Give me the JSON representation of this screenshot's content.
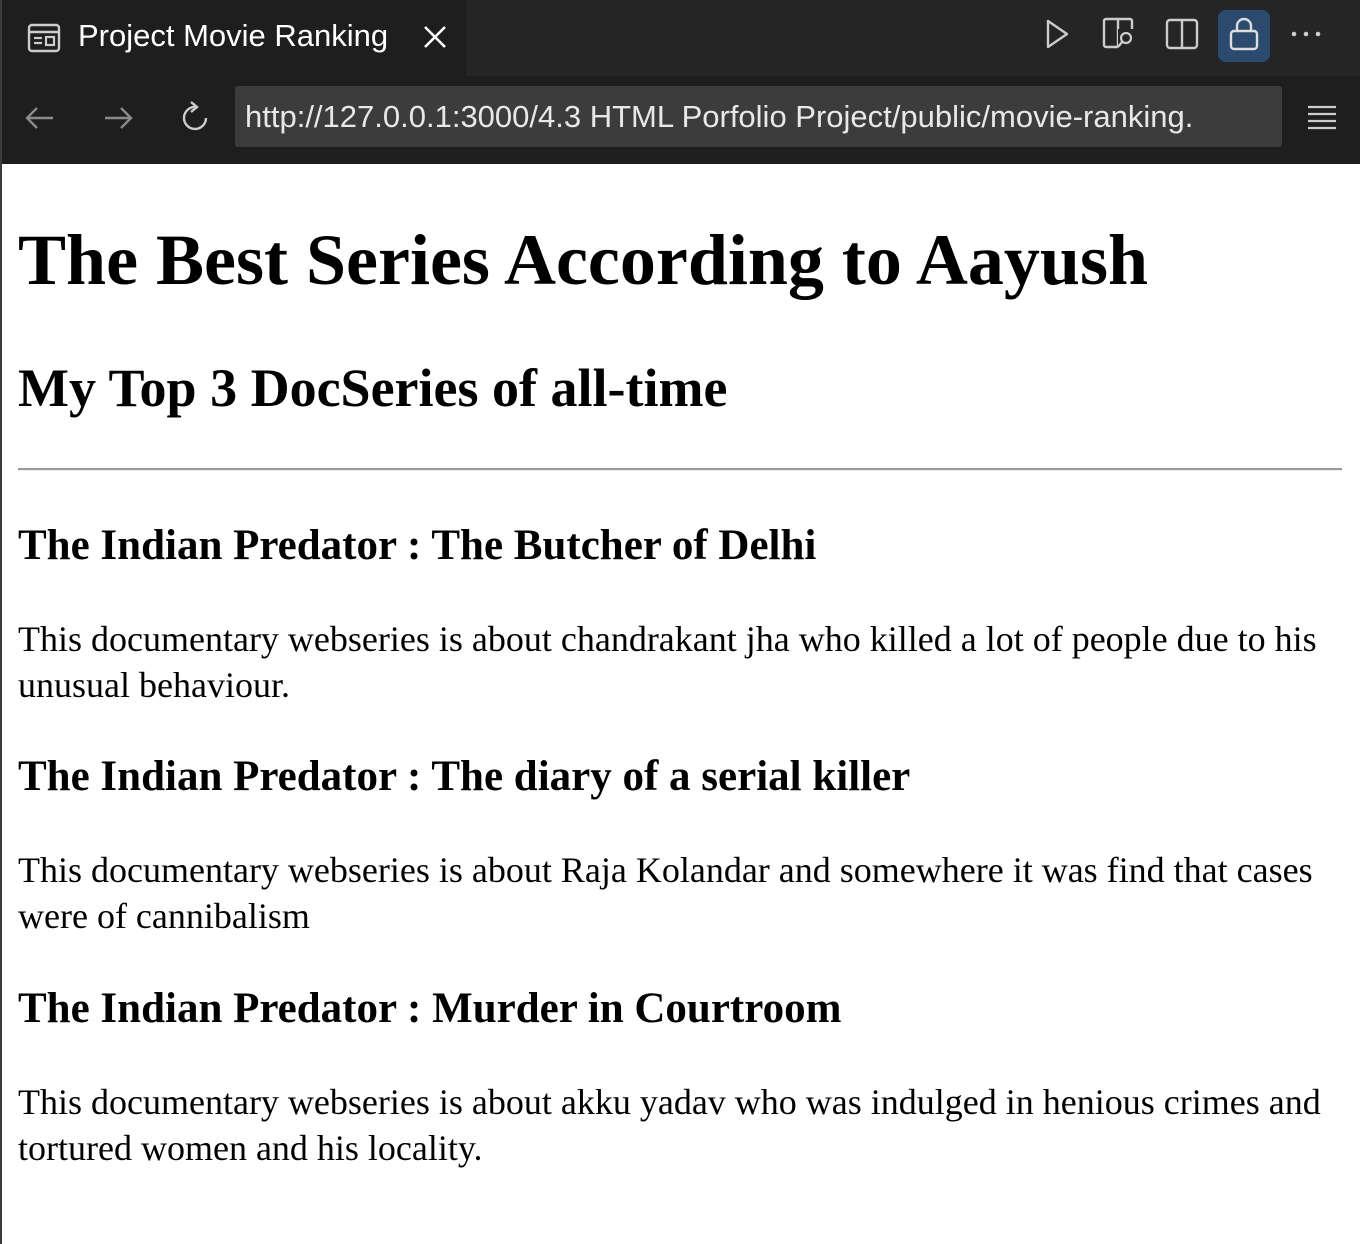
{
  "tab": {
    "title": "Project Movie Ranking",
    "icon": "preview-icon",
    "close_icon": "close-icon"
  },
  "toolbar": {
    "buttons": [
      "run-icon",
      "open-preview-icon",
      "split-editor-icon",
      "lock-icon",
      "more-actions-icon"
    ],
    "active_button": "lock-icon",
    "accent": "#2b4a6d"
  },
  "nav": {
    "back": "arrow-left-icon",
    "forward": "arrow-right-icon",
    "reload": "reload-icon",
    "url": "http://127.0.0.1:3000/4.3 HTML Porfolio Project/public/movie-ranking.",
    "menu": "menu-icon"
  },
  "page": {
    "heading": "The Best Series According to Aayush",
    "subheading": "My Top 3 DocSeries of all-time",
    "series": [
      {
        "title": "The Indian Predator : The Butcher of Delhi",
        "description": "This documentary webseries is about chandrakant jha who killed a lot of people due to his unusual behaviour."
      },
      {
        "title": "The Indian Predator : The diary of a serial killer",
        "description": "This documentary webseries is about Raja Kolandar and somewhere it was find that cases were of cannibalism"
      },
      {
        "title": "The Indian Predator : Murder in Courtroom",
        "description": "This documentary webseries is about akku yadav who was indulged in henious crimes and tortured women and his locality."
      }
    ]
  }
}
